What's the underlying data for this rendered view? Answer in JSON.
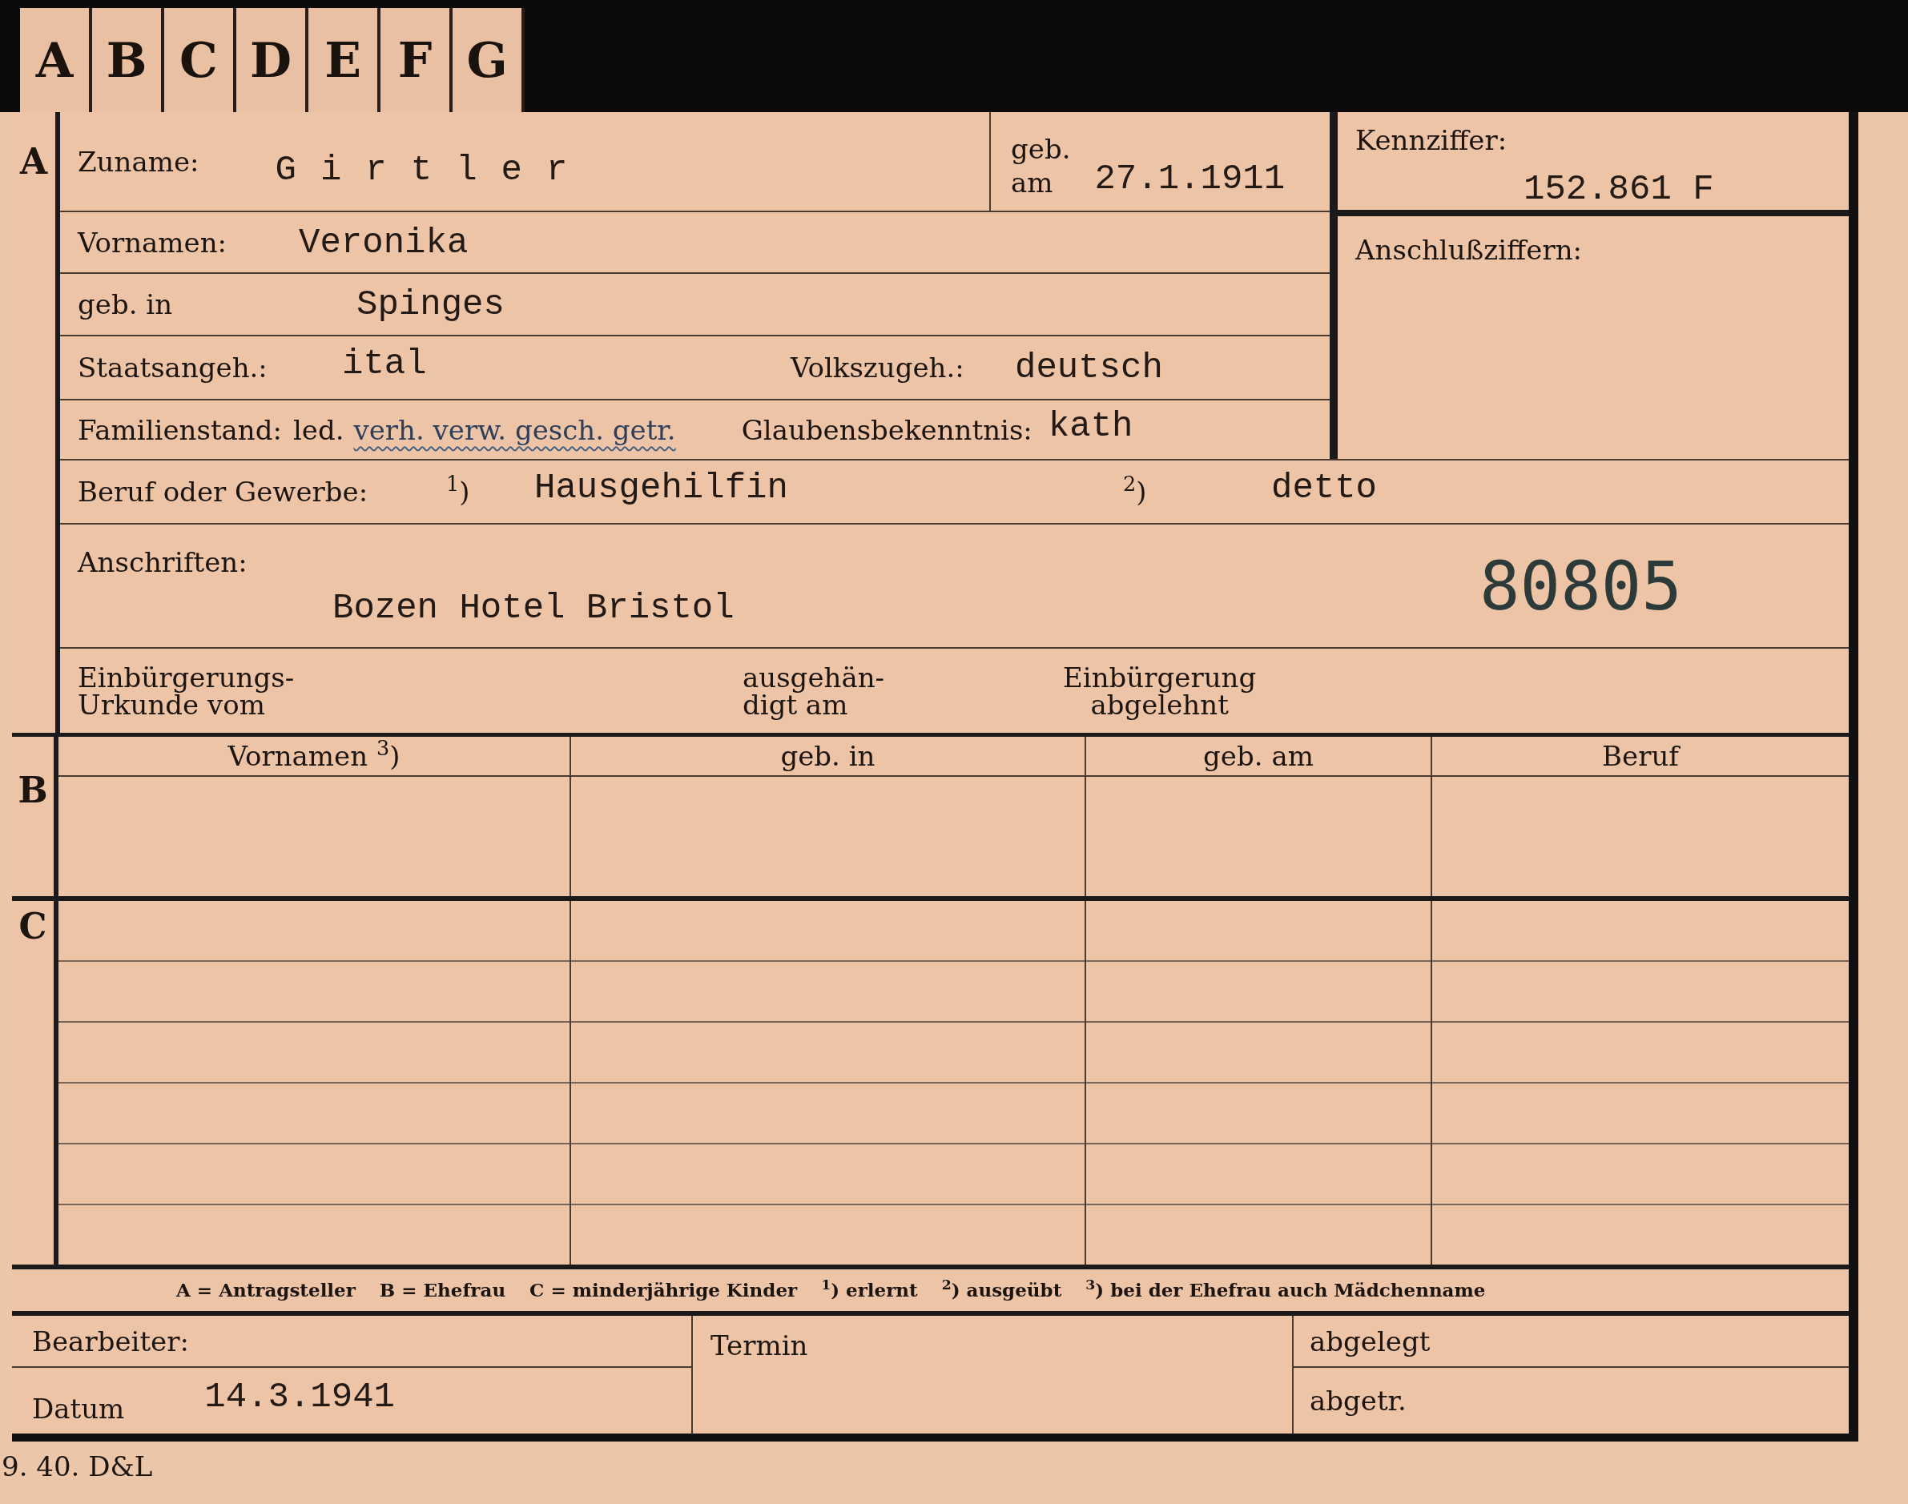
{
  "tabs": [
    "A",
    "B",
    "C",
    "D",
    "E",
    "F",
    "G"
  ],
  "section_a": {
    "letter": "A",
    "surname": {
      "label": "Zuname:",
      "value": "Girtler"
    },
    "birth_date": {
      "label_1": "geb.",
      "label_2": "am",
      "value": "27.1.1911"
    },
    "reference_number": {
      "label": "Kennziffer:",
      "value": "152.861 F"
    },
    "connection_numbers": {
      "label": "Anschlußziffern:"
    },
    "first_names": {
      "label": "Vornamen:",
      "value": "Veronika"
    },
    "birthplace": {
      "label": "geb. in",
      "value": "Spinges"
    },
    "citizenship": {
      "label": "Staatsangeh.:",
      "value": "ital"
    },
    "ethnicity": {
      "label": "Volkszugeh.:",
      "value": "deutsch"
    },
    "marital_status": {
      "label": "Familienstand:",
      "options": [
        {
          "text": "led.",
          "struck": false
        },
        {
          "text": "verh. verw. gesch. getr.",
          "struck": true
        }
      ]
    },
    "religion": {
      "label": "Glaubensbekenntnis:",
      "value": "kath"
    },
    "occupation": {
      "label": "Beruf oder Gewerbe:",
      "mark_1": "$^{1}$)",
      "value_1": "Hausgehilfin",
      "mark_2": "$^{2}$)",
      "value_2": "detto"
    },
    "addresses": {
      "label": "Anschriften:",
      "value": "Bozen Hotel Bristol",
      "stamp": "80805"
    },
    "naturalization": [
      "Einbürgerungs-\nUrkunde vom",
      "ausgehän-\ndigt am",
      "Einbürgerung\nabgelehnt"
    ]
  },
  "section_b": {
    "letter": "B",
    "columns": [
      "Vornamen $^{3}$)",
      "geb. in",
      "geb. am",
      "Beruf"
    ]
  },
  "section_c": {
    "letter": "C"
  },
  "legend": [
    "A = Antragsteller",
    "B = Ehefrau",
    "C = minderjährige Kinder",
    "$^{1}$) erlernt",
    "$^{2}$) ausgeübt",
    "$^{3}$) bei der Ehefrau auch Mädchenname"
  ],
  "footer": {
    "editor": {
      "label": "Bearbeiter:"
    },
    "date": {
      "label": "Datum",
      "value": "14.3.1941"
    },
    "deadline": {
      "label": "Termin"
    },
    "filed": {
      "label": "abgelegt"
    },
    "removed": {
      "label": "abgetr."
    }
  },
  "print_code": "9. 40. D&L"
}
